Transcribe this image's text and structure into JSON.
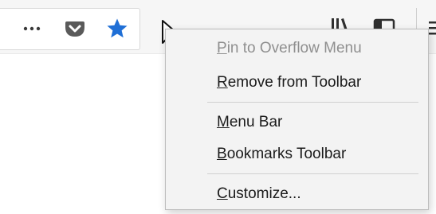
{
  "toolbar": {
    "icons": {
      "more": "meatball-icon",
      "pocket": "pocket-icon",
      "bookmark": "star-icon",
      "library": "library-icon",
      "sidebar": "sidebar-icon",
      "menu": "hamburger-icon"
    }
  },
  "context_menu": {
    "items": [
      {
        "accel": "P",
        "rest": "in to Overflow Menu",
        "disabled": true
      },
      {
        "accel": "R",
        "rest": "emove from Toolbar",
        "disabled": false
      },
      {
        "accel": "M",
        "rest": "enu Bar",
        "disabled": false
      },
      {
        "accel": "B",
        "rest": "ookmarks Toolbar",
        "disabled": false
      },
      {
        "accel": "C",
        "rest": "ustomize...",
        "disabled": false
      }
    ]
  },
  "colors": {
    "star": "#1f6fd6",
    "pocket": "#5a5a5a",
    "menu_bg": "#f3f3f3",
    "disabled_text": "#8f8f8f",
    "text": "#1b1b1b"
  }
}
